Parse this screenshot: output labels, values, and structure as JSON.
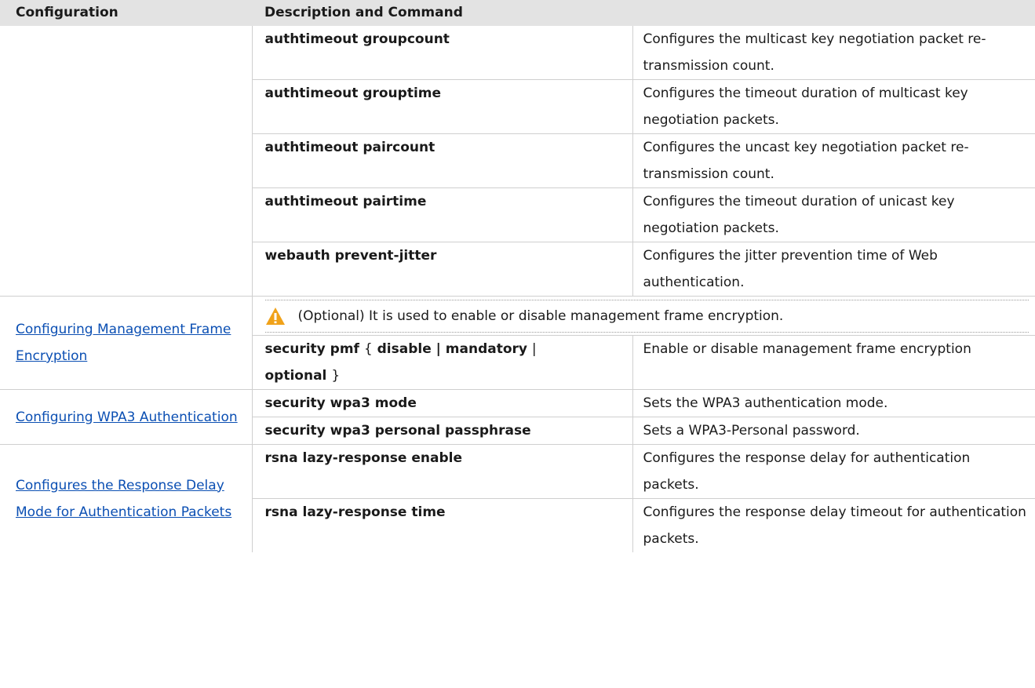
{
  "header": {
    "col1": "Configuration",
    "col2": "Description and Command"
  },
  "group1": {
    "rows": [
      {
        "command": "authtimeout groupcount",
        "description": "Configures the multicast key negotiation packet re-transmission count."
      },
      {
        "command": "authtimeout grouptime",
        "description": "Configures the timeout duration of multicast key negotiation packets."
      },
      {
        "command": "authtimeout paircount",
        "description": "Configures the uncast key negotiation packet re-transmission count."
      },
      {
        "command": "authtimeout pairtime",
        "description": "Configures the timeout duration of unicast key negotiation packets."
      },
      {
        "command": "webauth prevent-jitter",
        "description": "Configures the jitter prevention time of Web authentication."
      }
    ]
  },
  "pmf": {
    "link": "Configuring Management Frame Encryption",
    "note": "(Optional) It is used to enable or disable management frame encryption.",
    "note_icon": "warning-icon",
    "cmd_part1": "security pmf",
    "cmd_brace_open": "{",
    "cmd_disable": "disable | mandatory",
    "cmd_pipe": "|",
    "cmd_optional": "optional",
    "cmd_brace_close": "}",
    "description": "Enable or disable management frame encryption"
  },
  "wpa3": {
    "link": "Configuring WPA3 Authentication",
    "rows": [
      {
        "command": "security wpa3 mode",
        "description": "Sets the WPA3 authentication mode."
      },
      {
        "command": "security wpa3 personal passphrase",
        "description": "Sets a WPA3-Personal password."
      }
    ]
  },
  "rsna": {
    "link": "Configures the Response Delay Mode for Authentication Packets",
    "rows": [
      {
        "command": "rsna lazy-response enable",
        "description": "Configures the response delay for authentication packets."
      },
      {
        "command": "rsna lazy-response time",
        "description": "Configures the response delay timeout for authentication packets."
      }
    ]
  },
  "colors": {
    "header_bg": "#e3e3e3",
    "link": "#0b4fb3",
    "warning": "#f0a21a"
  }
}
